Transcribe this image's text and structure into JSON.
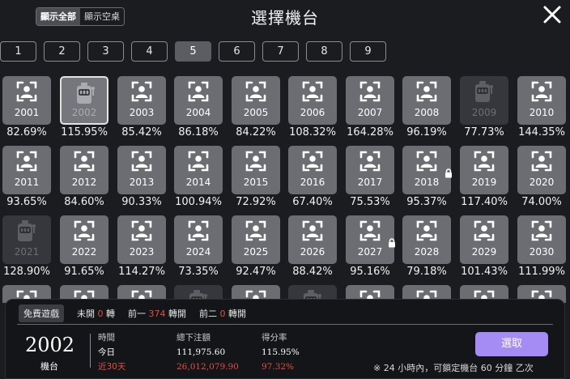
{
  "header": {
    "toggle_all": "顯示全部",
    "toggle_empty": "顯示空桌",
    "title": "選擇機台"
  },
  "pages": [
    "1",
    "2",
    "3",
    "4",
    "5",
    "6",
    "7",
    "8",
    "9"
  ],
  "active_page": 4,
  "machines": [
    {
      "id": "2001",
      "pct": "82.69%",
      "state": "normal"
    },
    {
      "id": "2002",
      "pct": "115.95%",
      "state": "selected"
    },
    {
      "id": "2003",
      "pct": "85.42%",
      "state": "normal"
    },
    {
      "id": "2004",
      "pct": "86.18%",
      "state": "normal"
    },
    {
      "id": "2005",
      "pct": "84.22%",
      "state": "normal"
    },
    {
      "id": "2006",
      "pct": "108.32%",
      "state": "normal"
    },
    {
      "id": "2007",
      "pct": "164.28%",
      "state": "normal"
    },
    {
      "id": "2008",
      "pct": "96.19%",
      "state": "normal"
    },
    {
      "id": "2009",
      "pct": "77.73%",
      "state": "faded"
    },
    {
      "id": "2010",
      "pct": "144.35%",
      "state": "normal"
    },
    {
      "id": "2011",
      "pct": "93.65%",
      "state": "normal"
    },
    {
      "id": "2012",
      "pct": "84.60%",
      "state": "normal"
    },
    {
      "id": "2013",
      "pct": "90.33%",
      "state": "normal"
    },
    {
      "id": "2014",
      "pct": "100.94%",
      "state": "normal"
    },
    {
      "id": "2015",
      "pct": "72.92%",
      "state": "normal"
    },
    {
      "id": "2016",
      "pct": "67.40%",
      "state": "normal"
    },
    {
      "id": "2017",
      "pct": "75.53%",
      "state": "normal"
    },
    {
      "id": "2018",
      "pct": "95.37%",
      "state": "locked"
    },
    {
      "id": "2019",
      "pct": "117.40%",
      "state": "normal"
    },
    {
      "id": "2020",
      "pct": "74.00%",
      "state": "normal"
    },
    {
      "id": "2021",
      "pct": "128.90%",
      "state": "faded"
    },
    {
      "id": "2022",
      "pct": "91.65%",
      "state": "normal"
    },
    {
      "id": "2023",
      "pct": "114.27%",
      "state": "normal"
    },
    {
      "id": "2024",
      "pct": "73.35%",
      "state": "normal"
    },
    {
      "id": "2025",
      "pct": "92.47%",
      "state": "normal"
    },
    {
      "id": "2026",
      "pct": "88.42%",
      "state": "normal"
    },
    {
      "id": "2027",
      "pct": "95.16%",
      "state": "locked"
    },
    {
      "id": "2028",
      "pct": "79.18%",
      "state": "normal"
    },
    {
      "id": "2029",
      "pct": "101.43%",
      "state": "normal"
    },
    {
      "id": "2030",
      "pct": "111.99%",
      "state": "normal"
    },
    {
      "id": "",
      "pct": "",
      "state": "normal"
    },
    {
      "id": "",
      "pct": "",
      "state": "normal"
    },
    {
      "id": "",
      "pct": "",
      "state": "normal"
    },
    {
      "id": "",
      "pct": "",
      "state": "faded"
    },
    {
      "id": "",
      "pct": "",
      "state": "normal"
    },
    {
      "id": "",
      "pct": "",
      "state": "faded"
    },
    {
      "id": "",
      "pct": "",
      "state": "normal"
    },
    {
      "id": "",
      "pct": "",
      "state": "normal"
    },
    {
      "id": "",
      "pct": "",
      "state": "normal"
    },
    {
      "id": "",
      "pct": "",
      "state": "normal"
    }
  ],
  "panel": {
    "tab_free": "免費遊戲",
    "tab_unopened_prefix": "未開",
    "tab_unopened_value": "0",
    "tab_unopened_suffix": "轉",
    "tab_prev1_prefix": "前一",
    "tab_prev1_value": "374",
    "tab_prev1_suffix": "轉開",
    "tab_prev2_prefix": "前二",
    "tab_prev2_value": "0",
    "tab_prev2_suffix": "轉開",
    "machine_number": "2002",
    "machine_label": "機台",
    "col_time_header": "時間",
    "col_time_today": "今日",
    "col_time_30": "近30天",
    "col_bet_header": "總下注額",
    "col_bet_today": "111,975.60",
    "col_bet_30": "26,012,079.90",
    "col_rate_header": "得分率",
    "col_rate_today": "115.95%",
    "col_rate_30": "97.32%",
    "claim_button": "選取",
    "note": "※ 24 小時內，可鎖定機台 60 分鐘 乙次"
  },
  "colors": {
    "accent": "#a58cf5",
    "highlight": "#e2503f"
  }
}
